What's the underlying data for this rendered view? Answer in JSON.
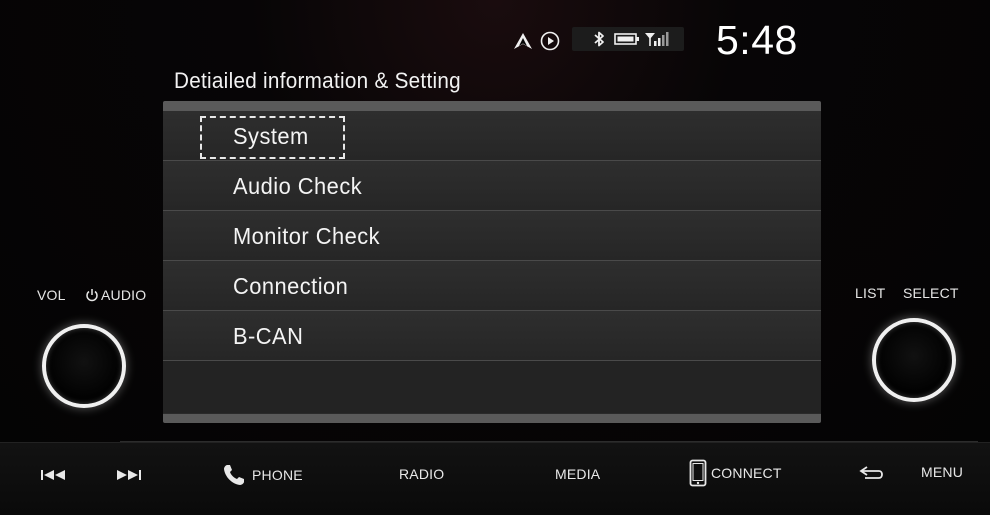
{
  "status_bar": {
    "icons": [
      "android-auto-icon",
      "play-icon",
      "bluetooth-icon",
      "battery-icon",
      "signal-icon"
    ],
    "clock": "5:48"
  },
  "screen": {
    "title": "Detiailed information & Setting",
    "menu_items": [
      {
        "label": "System",
        "focused": true
      },
      {
        "label": "Audio Check"
      },
      {
        "label": "Monitor Check"
      },
      {
        "label": "Connection"
      },
      {
        "label": "B-CAN"
      }
    ]
  },
  "left_controls": {
    "vol_label": "VOL",
    "audio_label": "AUDIO"
  },
  "right_controls": {
    "list_label": "LIST",
    "select_label": "SELECT"
  },
  "bottom_bar": {
    "phone_label": "PHONE",
    "radio_label": "RADIO",
    "media_label": "MEDIA",
    "connect_label": "CONNECT",
    "menu_label": "MENU"
  },
  "colors": {
    "background": "#050505",
    "panel": "#2a2a2a",
    "panel_frame": "#5a5a5a",
    "text": "#ffffff"
  }
}
